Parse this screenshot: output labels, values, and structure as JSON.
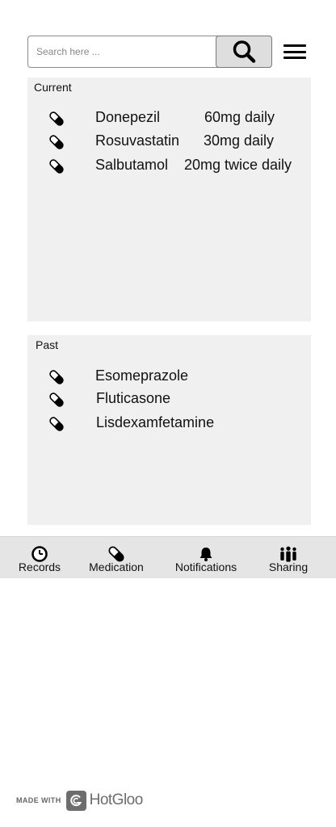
{
  "search": {
    "placeholder": "Search here ..."
  },
  "current": {
    "title": "Current",
    "items": [
      {
        "name": "Donepezil",
        "dose": "60mg daily"
      },
      {
        "name": "Rosuvastatin",
        "dose": "30mg daily"
      },
      {
        "name": "Salbutamol",
        "dose": "20mg twice daily"
      }
    ]
  },
  "past": {
    "title": "Past",
    "items": [
      {
        "name": "Esomeprazole"
      },
      {
        "name": "Fluticasone"
      },
      {
        "name": "Lisdexamfetamine"
      }
    ]
  },
  "nav": {
    "items": [
      {
        "label": "Records",
        "icon": "clock-icon"
      },
      {
        "label": "Medication",
        "icon": "pill-icon"
      },
      {
        "label": "Notifications",
        "icon": "bell-icon"
      },
      {
        "label": "Sharing",
        "icon": "people-icon"
      }
    ]
  },
  "footer": {
    "made_with": "MADE WITH",
    "brand": "HotGloo"
  }
}
